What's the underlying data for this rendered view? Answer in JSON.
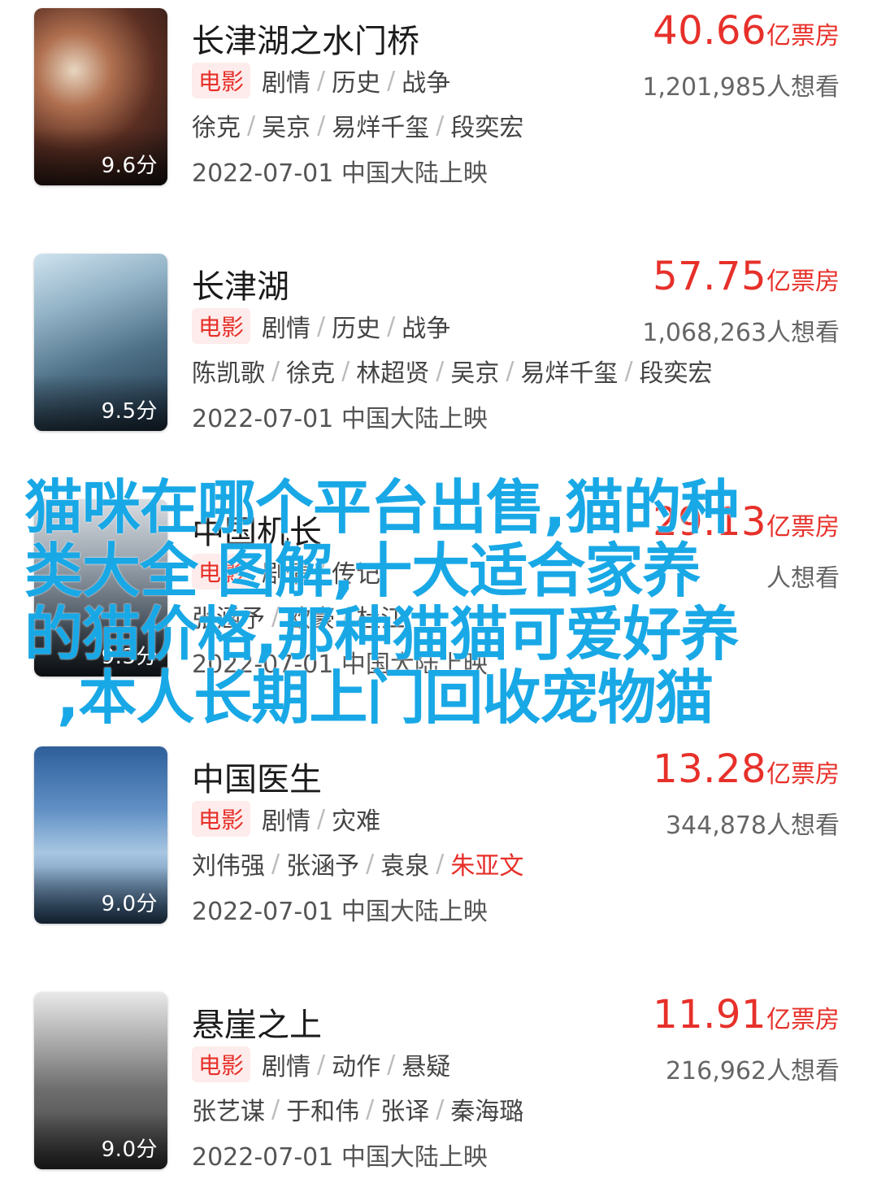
{
  "movies": [
    {
      "title": "长津湖之水门桥",
      "score": "9.6分",
      "box_num": "40.66",
      "box_unit": "亿票房",
      "badge": "电影",
      "genres": [
        "剧情",
        "历史",
        "战争"
      ],
      "want": "1,201,985人想看",
      "cast": [
        "徐克",
        "吴京",
        "易烊千玺",
        "段奕宏"
      ],
      "release": "2022-07-01 中国大陆上映"
    },
    {
      "title": "长津湖",
      "score": "9.5分",
      "box_num": "57.75",
      "box_unit": "亿票房",
      "badge": "电影",
      "genres": [
        "剧情",
        "历史",
        "战争"
      ],
      "want": "1,068,263人想看",
      "cast": [
        "陈凯歌",
        "徐克",
        "林超贤",
        "吴京",
        "易烊千玺",
        "段奕宏"
      ],
      "release": "2022-07-01 中国大陆上映"
    },
    {
      "title": "中国机长",
      "score": "9.3分",
      "box_num": "29.13",
      "box_unit": "亿票房",
      "badge": "电影",
      "genres": [
        "剧情",
        "传记"
      ],
      "want": "人想看",
      "cast": [
        "张涵予",
        "欧豪",
        "杜江"
      ],
      "release": "2022-07-01 中国大陆上映"
    },
    {
      "title": "中国医生",
      "score": "9.0分",
      "box_num": "13.28",
      "box_unit": "亿票房",
      "badge": "电影",
      "genres": [
        "剧情",
        "灾难"
      ],
      "want": "344,878人想看",
      "cast": [
        "刘伟强",
        "张涵予",
        "袁泉",
        "朱亚文"
      ],
      "release": "2022-07-01 中国大陆上映"
    },
    {
      "title": "悬崖之上",
      "score": "9.0分",
      "box_num": "11.91",
      "box_unit": "亿票房",
      "badge": "电影",
      "genres": [
        "剧情",
        "动作",
        "悬疑"
      ],
      "want": "216,962人想看",
      "cast": [
        "张艺谋",
        "于和伟",
        "张译",
        "秦海璐"
      ],
      "release": "2022-07-01 中国大陆上映"
    }
  ],
  "overlay_text": {
    "line1": "猫咪在哪个平台出售,猫的种",
    "line2": "类大全 图解,十大适合家养",
    "line3": "的猫价格,那种猫猫可爱好养",
    "line4": ",本人长期上门回收宠物猫"
  },
  "colors": {
    "accent": "#e7302a",
    "overlay": "#19a8e6"
  }
}
